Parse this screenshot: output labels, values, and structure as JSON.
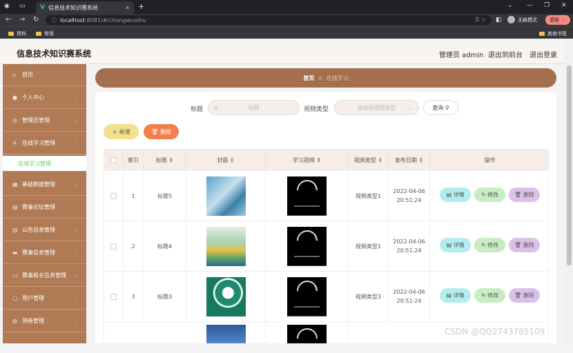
{
  "browser": {
    "tab_title": "信息技术知识赛系统",
    "url_host": "localhost",
    "url_rest": ":8081/#/chongwuxihu",
    "incognito_label": "无痕模式",
    "update_label": "更新",
    "bookmarks": [
      "资料",
      "常用"
    ],
    "other_bookmarks": "其他书签"
  },
  "header": {
    "site_title": "信息技术知识赛系统",
    "admin": "管理员 admin",
    "front": "退出到前台",
    "logout": "退出登录"
  },
  "sidebar": {
    "items": [
      {
        "label": "首页",
        "icon": "home-icon"
      },
      {
        "label": "个人中心",
        "icon": "user-icon"
      },
      {
        "label": "管理员管理",
        "icon": "admin-icon"
      },
      {
        "label": "在线学习管理",
        "icon": "learn-icon"
      },
      {
        "label": "基础数据管理",
        "icon": "data-icon"
      },
      {
        "label": "赛事论坛管理",
        "icon": "forum-icon"
      },
      {
        "label": "公告信息管理",
        "icon": "notice-icon"
      },
      {
        "label": "赛事信息管理",
        "icon": "event-icon"
      },
      {
        "label": "赛事报名信息管理",
        "icon": "signup-icon"
      },
      {
        "label": "用户管理",
        "icon": "users-icon"
      },
      {
        "label": "测卷管理",
        "icon": "exam-icon"
      }
    ],
    "sub_item": "在线学习管理"
  },
  "breadcrumb": {
    "home": "首页",
    "current": "在线学习"
  },
  "filter": {
    "title_label": "标题",
    "title_placeholder": "标题",
    "type_label": "视频类型",
    "type_placeholder": "请选择视频类型",
    "query": "查询"
  },
  "actions": {
    "add": "新增",
    "delete": "删除"
  },
  "table": {
    "headers": [
      "索引",
      "标题",
      "封面",
      "学习视频",
      "视频类型",
      "发布日期",
      "操作"
    ],
    "rows": [
      {
        "index": "1",
        "title": "标题5",
        "type": "视频类型1",
        "date": "2022-04-06",
        "time": "20:51:24"
      },
      {
        "index": "2",
        "title": "标题4",
        "type": "视频类型1",
        "date": "2022-04-06",
        "time": "20:51:24"
      },
      {
        "index": "3",
        "title": "标题3",
        "type": "视频类型3",
        "date": "2022-04-06",
        "time": "20:51:24"
      }
    ],
    "btn_detail": "详情",
    "btn_edit": "修改",
    "btn_delete": "删除"
  },
  "watermark": "CSDN @QQ2743785109",
  "colors": {
    "sidebar": "#b07a54",
    "breadcrumb": "#a36f4f",
    "add": "#f1e08d",
    "delete": "#f47f4e",
    "detail": "#b3ecef",
    "edit": "#c8ecc4",
    "remove": "#dcc0ea"
  }
}
